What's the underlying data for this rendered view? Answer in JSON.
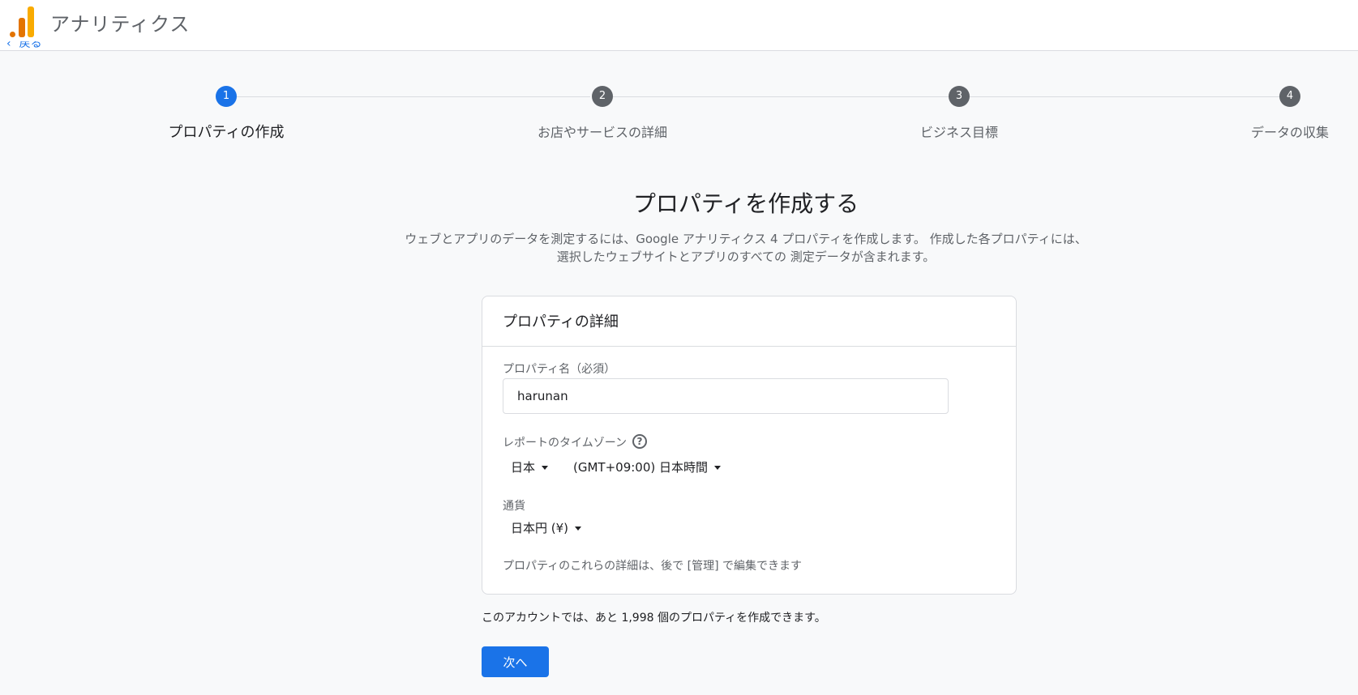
{
  "header": {
    "app_title": "アナリティクス",
    "back_label": "戻る",
    "logo_icon": "analytics-logo-icon"
  },
  "stepper": {
    "steps": [
      {
        "number": "1",
        "label": "プロパティの作成",
        "active": true
      },
      {
        "number": "2",
        "label": "お店やサービスの詳細",
        "active": false
      },
      {
        "number": "3",
        "label": "ビジネス目標",
        "active": false
      },
      {
        "number": "4",
        "label": "データの収集",
        "active": false
      }
    ]
  },
  "main": {
    "title": "プロパティを作成する",
    "intro_line1": "ウェブとアプリのデータを測定するには、Google アナリティクス 4 プロパティを作成します。 作成した各プロパティには、",
    "intro_line2": "選択したウェブサイトとアプリのすべての 測定データが含まれます。"
  },
  "card": {
    "header": "プロパティの詳細",
    "property_name_label": "プロパティ名（必須）",
    "property_name_value": "harunan",
    "timezone_label": "レポートのタイムゾーン",
    "timezone_country": "日本",
    "timezone_value": "(GMT+09:00) 日本時間",
    "currency_label": "通貨",
    "currency_value": "日本円 (¥)",
    "note": "プロパティのこれらの詳細は、後で [管理] で編集できます"
  },
  "footer": {
    "remaining_text": "このアカウントでは、あと 1,998 個のプロパティを作成できます。",
    "next_label": "次へ"
  },
  "colors": {
    "accent": "#1a73e8",
    "logo_orange": "#e37400",
    "logo_yellow": "#f9ab00"
  }
}
